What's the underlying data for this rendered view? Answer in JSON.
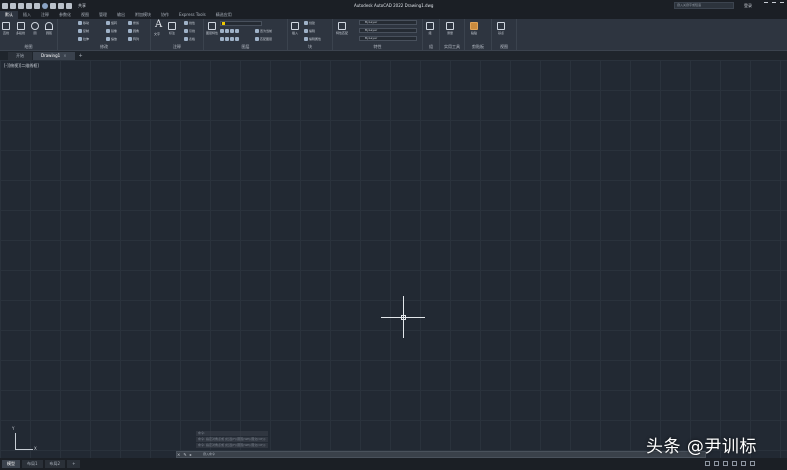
{
  "window": {
    "title": "Autodesk AutoCAD 2022   Drawing1.dwg",
    "share_label": "共享",
    "search_placeholder": "键入关键字或短语",
    "user_label": "登录"
  },
  "menu_tabs": [
    "默认",
    "插入",
    "注释",
    "参数化",
    "视图",
    "管理",
    "输出",
    "附加模块",
    "协作",
    "Express Tools",
    "精选应用"
  ],
  "ribbon": {
    "draw": {
      "title": "绘图",
      "buttons": [
        "直线",
        "多段线",
        "圆",
        "圆弧"
      ]
    },
    "modify": {
      "title": "修改",
      "items": [
        "移动",
        "旋转",
        "修剪",
        "复制",
        "镜像",
        "圆角",
        "拉伸",
        "缩放",
        "阵列"
      ]
    },
    "annotation": {
      "title": "注释",
      "buttons": [
        "文字",
        "标注"
      ],
      "items": [
        "线性",
        "引线",
        "表格"
      ]
    },
    "layers": {
      "title": "图层",
      "buttons": [
        "图层特性"
      ],
      "items": [
        "置为当前",
        "匹配图层"
      ]
    },
    "block": {
      "title": "块",
      "buttons": [
        "插入"
      ],
      "items": [
        "创建",
        "编辑",
        "编辑属性"
      ]
    },
    "properties": {
      "title": "特性",
      "buttons": [
        "特性匹配"
      ],
      "combos": [
        "ByLayer",
        "ByLayer",
        "ByLayer"
      ]
    },
    "groups": {
      "title": "组",
      "buttons": [
        "组"
      ]
    },
    "utilities": {
      "title": "实用工具",
      "buttons": [
        "测量"
      ]
    },
    "clipboard": {
      "title": "剪贴板",
      "buttons": [
        "粘贴"
      ]
    },
    "view": {
      "title": "视图",
      "buttons": [
        "基点"
      ]
    }
  },
  "doc_tabs": {
    "start": "开始",
    "active": "Drawing1",
    "close": "×",
    "add": "+"
  },
  "viewport_label": "[-][俯视][二维线框]",
  "ucs": {
    "x": "X",
    "y": "Y"
  },
  "command": {
    "history": [
      "命令:",
      "命令: 指定对角点或 [栏选(F)/圈围(WP)/圈交(CP)]:",
      "命令: 指定对角点或 [栏选(F)/圈围(WP)/圈交(CP)]:"
    ],
    "placeholder": "键入命令"
  },
  "layout_tabs": [
    "模型",
    "布局1",
    "布局2",
    "+"
  ],
  "watermark": "头条 @尹训标"
}
